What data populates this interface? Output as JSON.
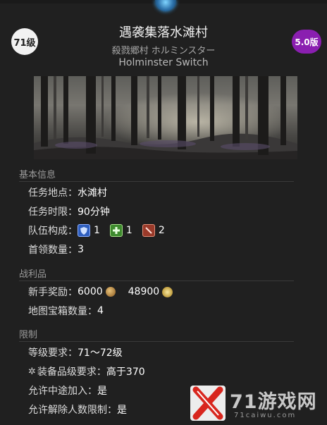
{
  "header": {
    "level_badge": "71级",
    "version_badge": "5.0版",
    "title": "遇袭集落水滩村",
    "subtitle_jp": "殺戮郷村 ホルミンスター",
    "subtitle_en": "Holminster Switch"
  },
  "sections": {
    "basic": {
      "header": "基本信息",
      "location_label": "任务地点：",
      "location_value": "水滩村",
      "time_label": "任务时限：",
      "time_value": "90分钟",
      "party_label": "队伍构成：",
      "party": [
        {
          "role": "tank",
          "count": "1"
        },
        {
          "role": "healer",
          "count": "1"
        },
        {
          "role": "dps",
          "count": "2"
        }
      ],
      "boss_label": "首领数量：",
      "boss_value": "3"
    },
    "loot": {
      "header": "战利品",
      "novice_label": "新手奖励：",
      "novice_gil": "6000",
      "novice_exp": "48900",
      "chest_label": "地图宝箱数量：",
      "chest_value": "4"
    },
    "limits": {
      "header": "限制",
      "level_label": "等级要求：",
      "level_value": "71～72级",
      "ilvl_label": "装备品级要求：",
      "ilvl_value": "高于370",
      "join_label": "允许中途加入：",
      "join_value": "是",
      "release_label": "允许解除人数限制：",
      "release_value": "是"
    }
  },
  "watermark": {
    "text": "71游戏网",
    "url": "71caiwu.com"
  },
  "colors": {
    "background": "#202020",
    "version_purple": "#8a1fb0",
    "section_header": "#9a9a9a"
  }
}
